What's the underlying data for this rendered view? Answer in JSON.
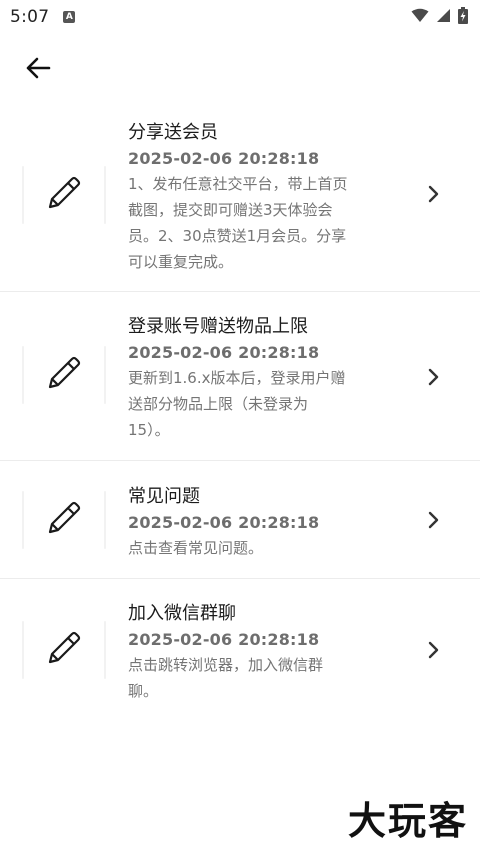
{
  "status_bar": {
    "time": "5:07",
    "notification_badge": "A",
    "icons": [
      "wifi-icon",
      "signal-icon",
      "battery-charging-icon"
    ]
  },
  "nav": {
    "back_icon": "arrow-left-icon"
  },
  "items": [
    {
      "title": "分享送会员",
      "date": "2025-02-06 20:28:18",
      "description_lines": [
        "1、发布任意社交平台，带上首页",
        "截图，提交即可赠送3天体验会",
        "员。2、30点赞送1月会员。分享",
        "可以重复完成。"
      ],
      "icon": "pencil-icon"
    },
    {
      "title": "登录账号赠送物品上限",
      "date": "2025-02-06 20:28:18",
      "description_lines": [
        "更新到1.6.x版本后，登录用户赠",
        "送部分物品上限（未登录为",
        "15）。"
      ],
      "icon": "pencil-icon"
    },
    {
      "title": "常见问题",
      "date": "2025-02-06 20:28:18",
      "description_lines": [
        "点击查看常见问题。"
      ],
      "icon": "pencil-icon"
    },
    {
      "title": "加入微信群聊",
      "date": "2025-02-06 20:28:18",
      "description_lines": [
        "点击跳转浏览器，加入微信群",
        "聊。"
      ],
      "icon": "pencil-icon"
    }
  ],
  "watermark": "大玩客",
  "colors": {
    "background": "#ffffff",
    "title": "#1c1c1c",
    "date": "#6e6e6e",
    "description": "#757575",
    "divider": "#ececec"
  }
}
